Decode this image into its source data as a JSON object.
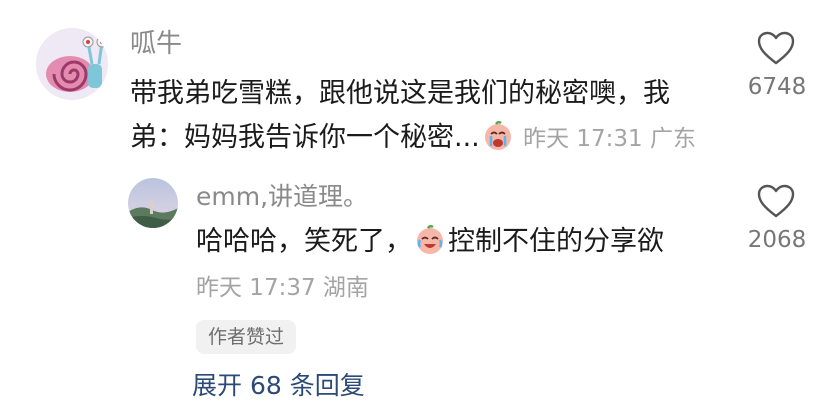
{
  "main_comment": {
    "username": "呱牛",
    "text_line1": "带我弟吃雪糕，跟他说这是我们的秘密噢，我",
    "text_line2": "弟：妈妈我告诉你一个秘密...",
    "timestamp": "昨天 17:31",
    "location": "广东",
    "like_count": "6748",
    "avatar_icon": "snail-avatar",
    "emoji_icon": "crying-face-emoji"
  },
  "reply": {
    "username": "emm,讲道理。",
    "text_before_emoji": "哈哈哈，笑死了，",
    "text_after_emoji": "控制不住的分享欲",
    "timestamp": "昨天 17:37",
    "location": "湖南",
    "like_count": "2068",
    "author_liked_badge": "作者赞过",
    "emoji_icon": "laughing-crying-emoji"
  },
  "expand_replies_label": "展开 68 条回复",
  "colors": {
    "meta_gray": "#a4a4a4",
    "username_gray": "#8a8a8a",
    "link_blue": "#2c4a78",
    "badge_bg": "#f1f1f1"
  }
}
